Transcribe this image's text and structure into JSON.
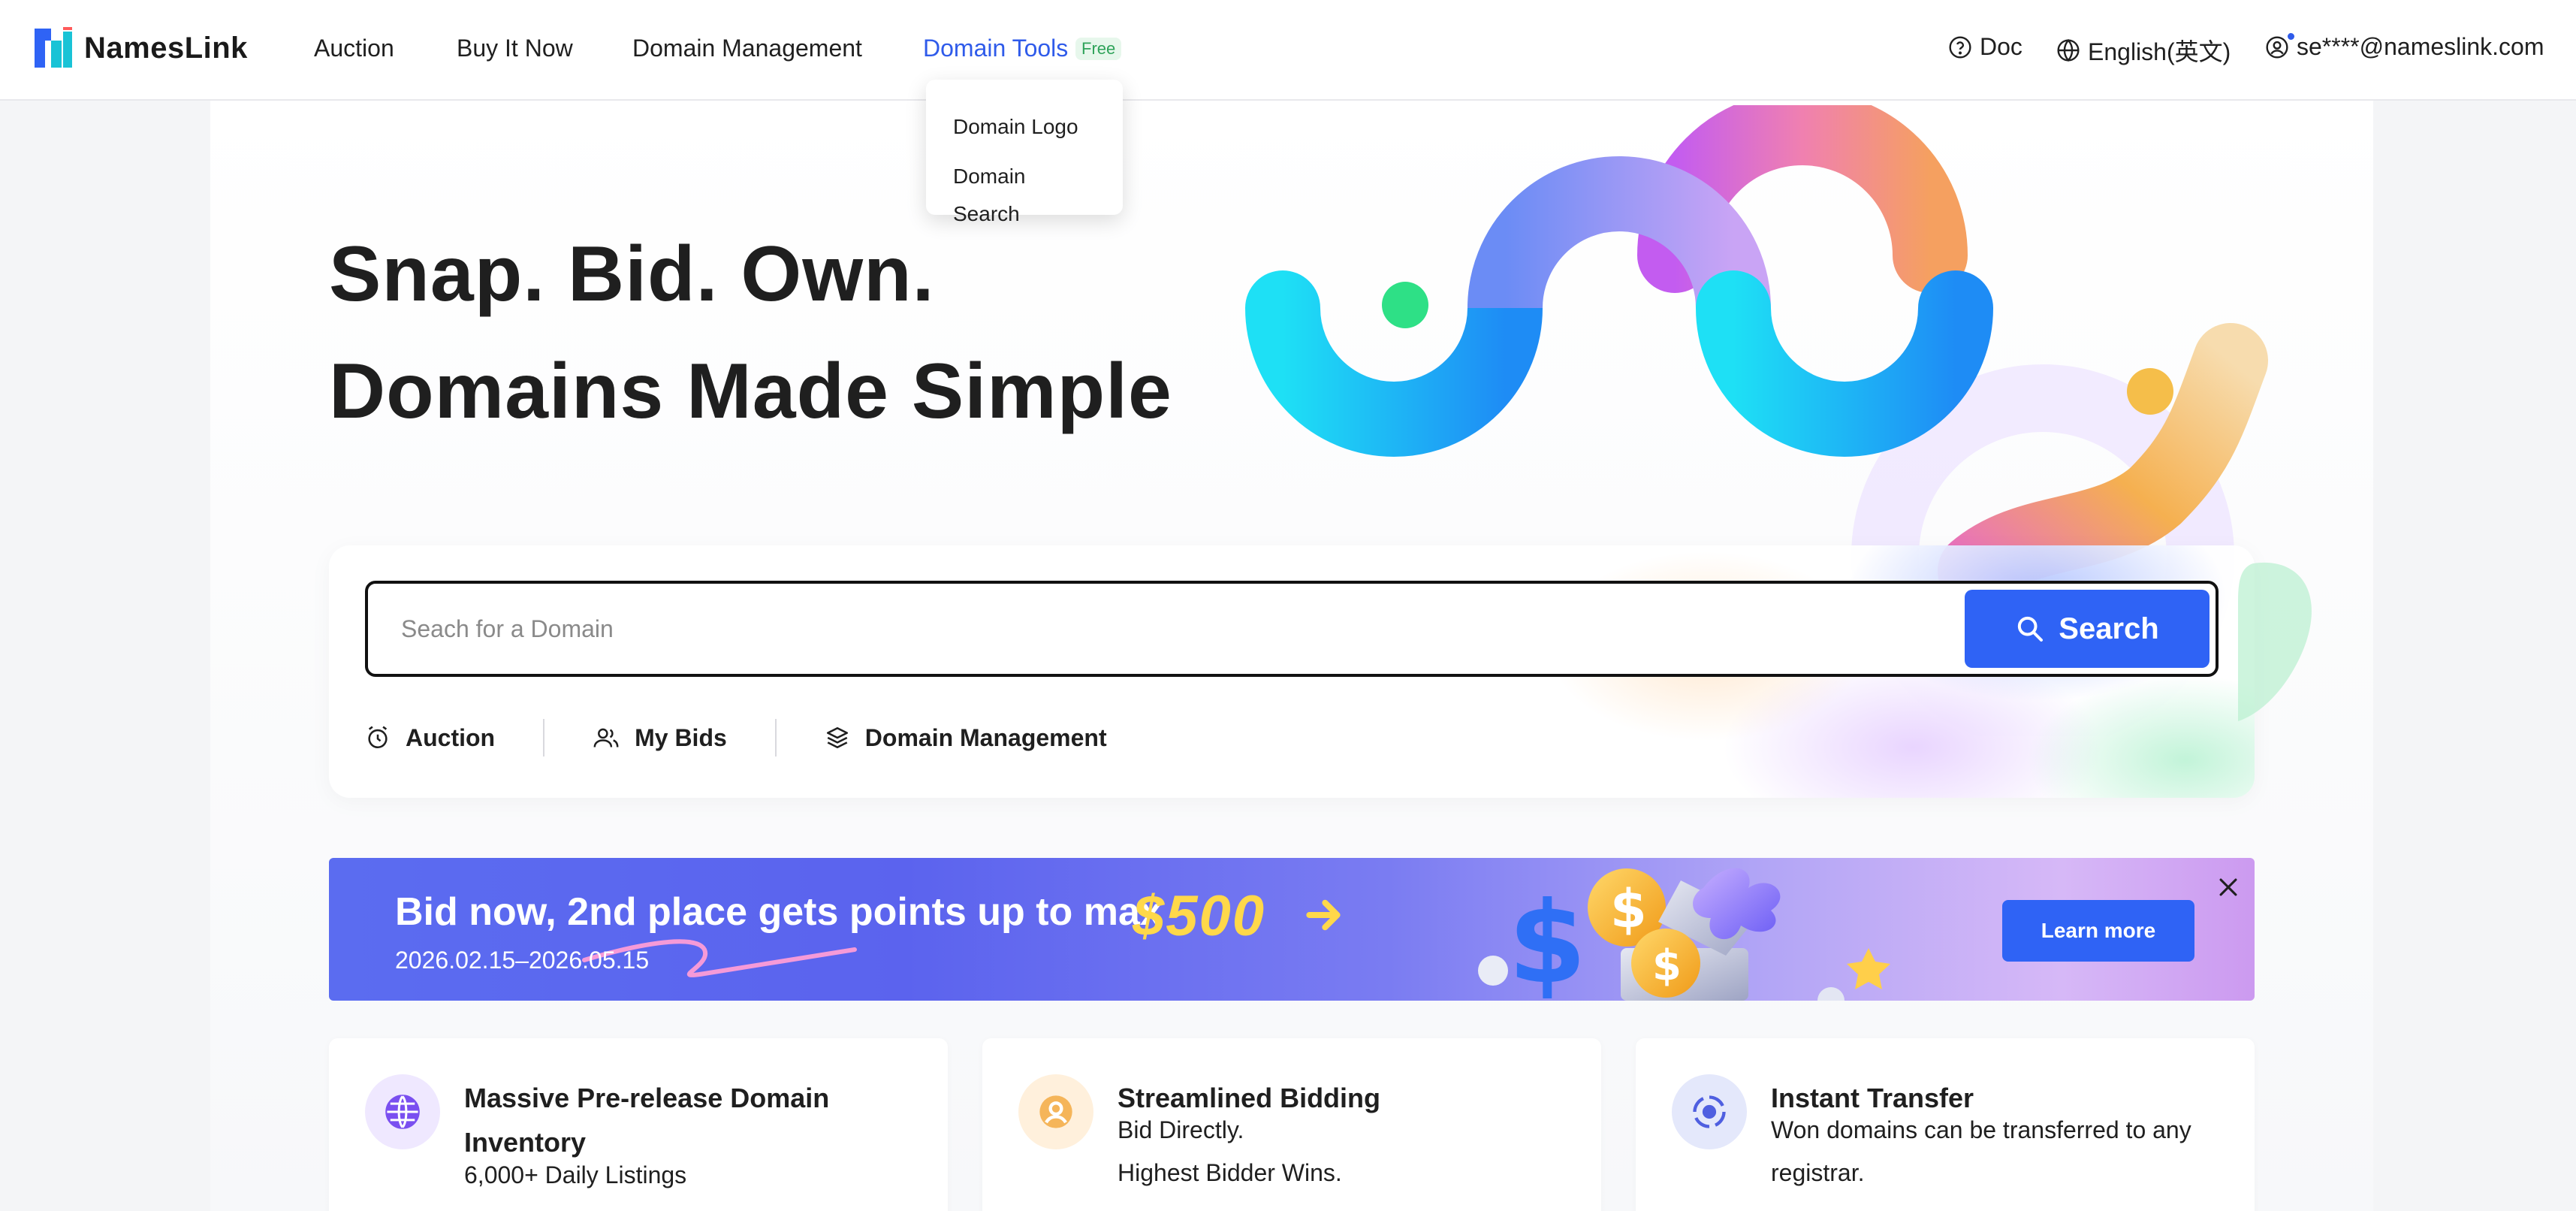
{
  "brand": {
    "name": "NamesLink"
  },
  "nav": {
    "items": [
      {
        "label": "Auction"
      },
      {
        "label": "Buy It Now"
      },
      {
        "label": "Domain Management"
      },
      {
        "label": "Domain Tools",
        "badge": "Free",
        "active": true
      }
    ],
    "doc_label": "Doc",
    "language_label": "English(英文)",
    "account_label": "se****@nameslink.com"
  },
  "dropdown": {
    "items": [
      {
        "label": "Domain Logo"
      },
      {
        "label": "Domain Search"
      }
    ]
  },
  "hero": {
    "title_line1": "Snap. Bid. Own.",
    "title_line2": "Domains Made Simple"
  },
  "search": {
    "placeholder": "Seach for a Domain",
    "value": "",
    "button_label": "Search"
  },
  "quick_links": [
    {
      "label": "Auction",
      "icon": "alarm-clock-icon"
    },
    {
      "label": "My Bids",
      "icon": "users-icon"
    },
    {
      "label": "Domain Management",
      "icon": "layers-icon"
    }
  ],
  "banner": {
    "title": "Bid now, 2nd place gets points up to max",
    "amount": "$500",
    "date_range": "2026.02.15–2026.05.15",
    "cta_label": "Learn more"
  },
  "features": [
    {
      "title": "Massive Pre-release Domain Inventory",
      "desc_lines": [
        "6,000+ Daily Listings"
      ],
      "icon": "globe-icon"
    },
    {
      "title": "Streamlined Bidding",
      "desc_lines": [
        "Bid Directly.",
        "Highest Bidder Wins."
      ],
      "icon": "user-circle-icon"
    },
    {
      "title": "Instant Transfer",
      "desc_lines": [
        "Won domains can be transferred to any",
        "registrar."
      ],
      "icon": "transfer-icon"
    }
  ],
  "colors": {
    "accent": "#2f63f5",
    "nav_active": "#2f5bea",
    "banner_amount": "#ffd84a",
    "free_badge": "#2fa35a"
  }
}
